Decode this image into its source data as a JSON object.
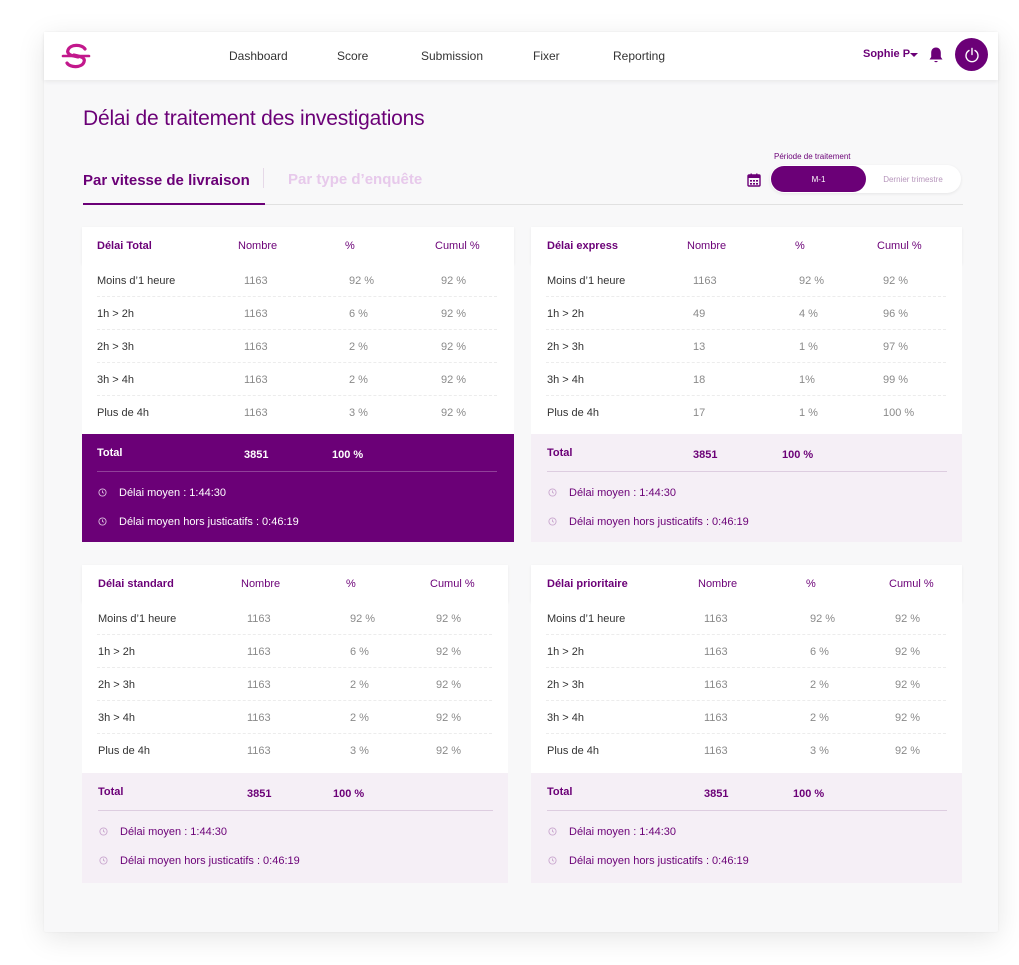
{
  "colors": {
    "brand": "#6b0077",
    "brand_light": "#f5eff6",
    "tab_inactive": "#e7c9eb"
  },
  "header": {
    "nav": [
      "Dashboard",
      "Score",
      "Submission",
      "Fixer",
      "Reporting"
    ],
    "user_name": "Sophie P",
    "icons": [
      "logo-icon",
      "caret-down-icon",
      "bell-icon",
      "power-icon"
    ]
  },
  "page": {
    "title": "Délai de traitement des investigations",
    "tabs": [
      "Par vitesse de livraison",
      "Par type d’enquête"
    ],
    "active_tab": 0
  },
  "period": {
    "label": "Période de traitement",
    "options": [
      "M-1",
      "Dernier trimestre"
    ],
    "selected": "M-1"
  },
  "tables": [
    {
      "title": "Délai Total",
      "cols": [
        "Nombre",
        "%",
        "Cumul %"
      ],
      "rows": [
        [
          "Moins d’1 heure",
          "1163",
          "92 %",
          "92 %"
        ],
        [
          "1h > 2h",
          "1163",
          "6 %",
          "92 %"
        ],
        [
          "2h > 3h",
          "1163",
          "2 %",
          "92 %"
        ],
        [
          "3h > 4h",
          "1163",
          "2 %",
          "92 %"
        ],
        [
          "Plus de 4h",
          "1163",
          "3 %",
          "92 %"
        ]
      ],
      "total_label": "Total",
      "total_count": "3851",
      "total_pct": "100 %",
      "avg": "Délai moyen : 1:44:30",
      "avg_excl": "Délai moyen hors justicatifs : 0:46:19",
      "highlight": true
    },
    {
      "title": "Délai express",
      "cols": [
        "Nombre",
        "%",
        "Cumul %"
      ],
      "rows": [
        [
          "Moins d’1 heure",
          "1163",
          "92 %",
          "92 %"
        ],
        [
          "1h > 2h",
          "49",
          "4 %",
          "96 %"
        ],
        [
          "2h > 3h",
          "13",
          "1 %",
          "97 %"
        ],
        [
          "3h > 4h",
          "18",
          "1%",
          "99 %"
        ],
        [
          "Plus de 4h",
          "17",
          "1 %",
          "100 %"
        ]
      ],
      "total_label": "Total",
      "total_count": "3851",
      "total_pct": "100 %",
      "avg": "Délai moyen : 1:44:30",
      "avg_excl": "Délai moyen hors justicatifs : 0:46:19",
      "highlight": false
    },
    {
      "title": "Délai standard",
      "cols": [
        "Nombre",
        "%",
        "Cumul %"
      ],
      "rows": [
        [
          "Moins d’1 heure",
          "1163",
          "92 %",
          "92 %"
        ],
        [
          "1h > 2h",
          "1163",
          "6 %",
          "92 %"
        ],
        [
          "2h > 3h",
          "1163",
          "2 %",
          "92 %"
        ],
        [
          "3h > 4h",
          "1163",
          "2 %",
          "92 %"
        ],
        [
          "Plus de 4h",
          "1163",
          "3 %",
          "92 %"
        ]
      ],
      "total_label": "Total",
      "total_count": "3851",
      "total_pct": "100 %",
      "avg": "Délai moyen : 1:44:30",
      "avg_excl": "Délai moyen hors justicatifs : 0:46:19",
      "highlight": false
    },
    {
      "title": "Délai prioritaire",
      "cols": [
        "Nombre",
        "%",
        "Cumul %"
      ],
      "rows": [
        [
          "Moins d’1 heure",
          "1163",
          "92 %",
          "92 %"
        ],
        [
          "1h > 2h",
          "1163",
          "6 %",
          "92 %"
        ],
        [
          "2h > 3h",
          "1163",
          "2 %",
          "92 %"
        ],
        [
          "3h > 4h",
          "1163",
          "2 %",
          "92 %"
        ],
        [
          "Plus de 4h",
          "1163",
          "3 %",
          "92 %"
        ]
      ],
      "total_label": "Total",
      "total_count": "3851",
      "total_pct": "100 %",
      "avg": "Délai moyen : 1:44:30",
      "avg_excl": "Délai moyen hors justicatifs : 0:46:19",
      "highlight": false
    }
  ]
}
